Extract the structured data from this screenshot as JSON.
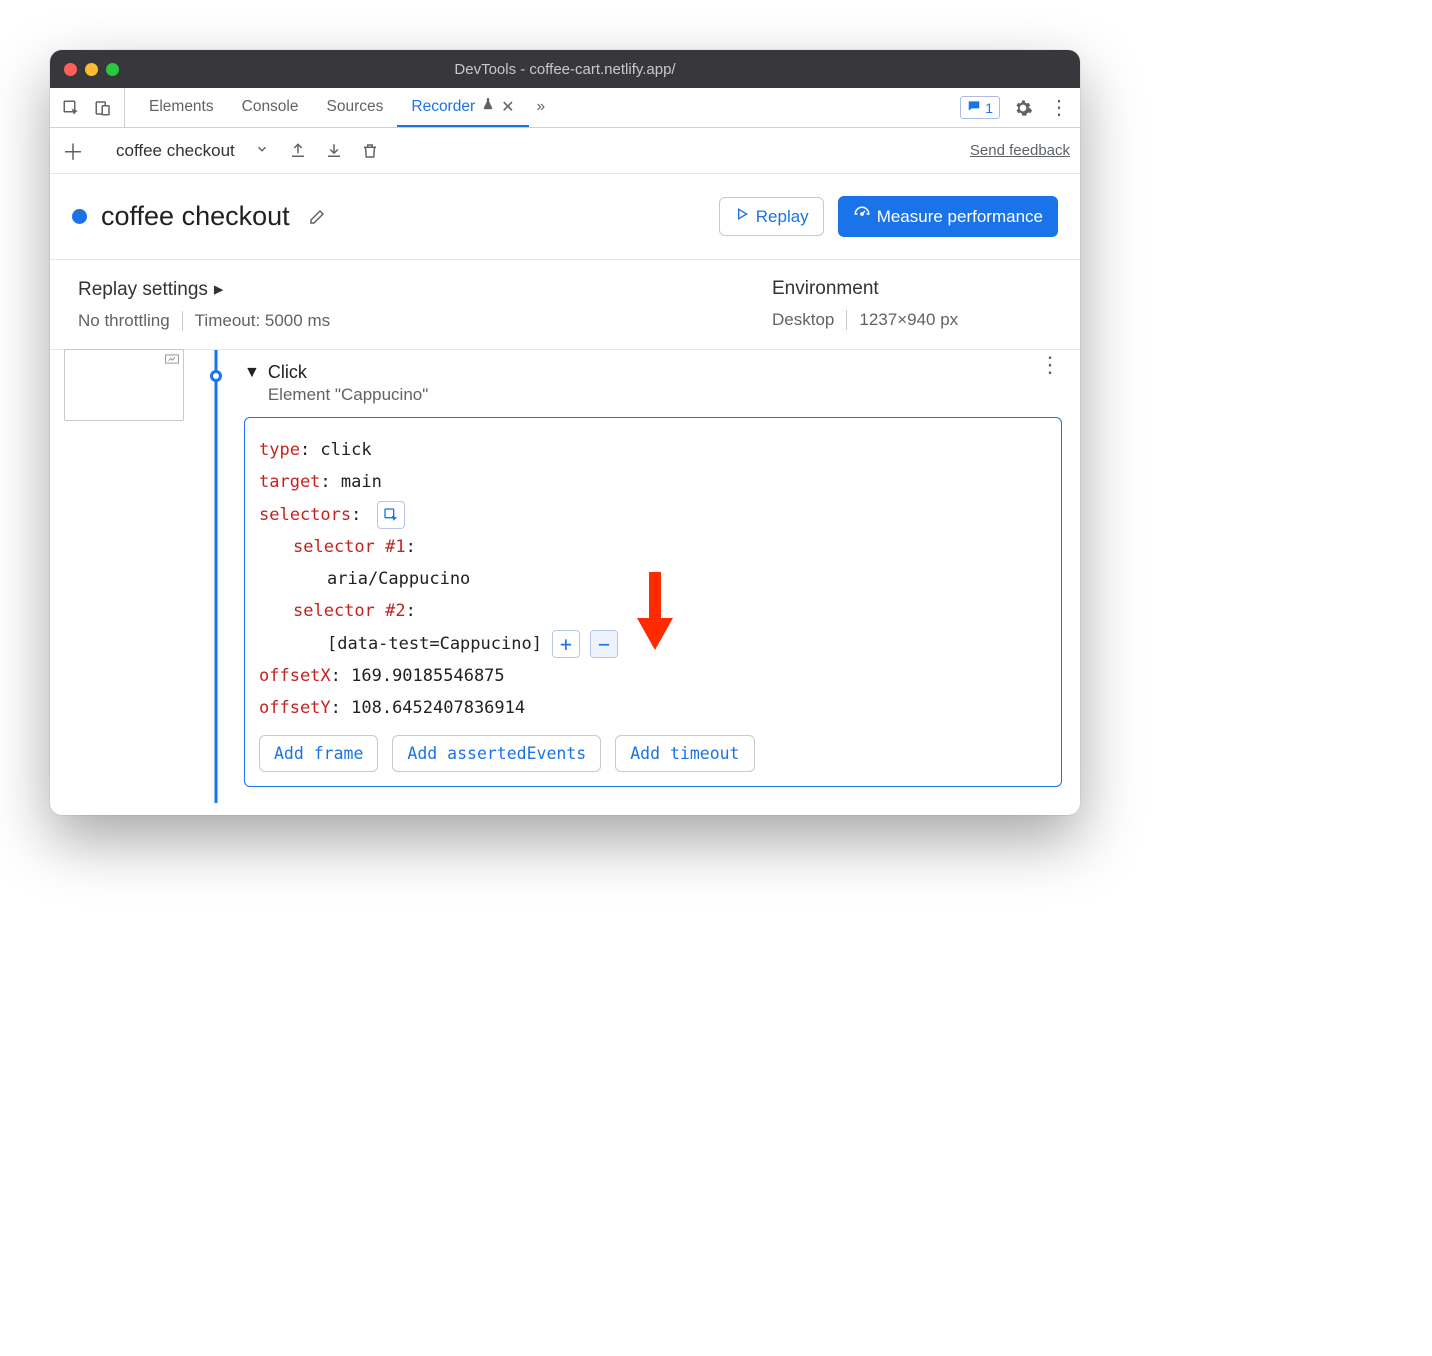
{
  "window_title": "DevTools - coffee-cart.netlify.app/",
  "tabs": {
    "elements": "Elements",
    "console": "Console",
    "sources": "Sources",
    "recorder": "Recorder"
  },
  "issues_count": "1",
  "recording_selector": "coffee checkout",
  "feedback": "Send feedback",
  "recording_title": "coffee checkout",
  "replay_btn": "Replay",
  "measure_btn": "Measure performance",
  "replay_settings_heading": "Replay settings",
  "throttling": "No throttling",
  "timeout": "Timeout: 5000 ms",
  "environment_heading": "Environment",
  "device": "Desktop",
  "dimensions": "1237×940 px",
  "step": {
    "title": "Click",
    "subtitle": "Element \"Cappucino\"",
    "type_k": "type",
    "type_v": ": click",
    "target_k": "target",
    "target_v": ": main",
    "selectors_k": "selectors",
    "selectors_colon": ":",
    "sel1_k": "selector #1",
    "sel1_colon": ":",
    "sel1_v": "aria/Cappucino",
    "sel2_k": "selector #2",
    "sel2_colon": ":",
    "sel2_v": "[data-test=Cappucino]",
    "offx_k": "offsetX",
    "offx_v": ": 169.90185546875",
    "offy_k": "offsetY",
    "offy_v": ": 108.6452407836914"
  },
  "actions": {
    "frame": "Add frame",
    "asserted": "Add assertedEvents",
    "timeout": "Add timeout"
  }
}
